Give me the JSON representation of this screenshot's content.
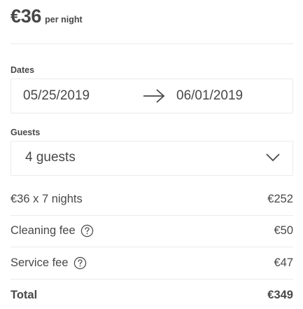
{
  "price": {
    "amount": "€36",
    "suffix": "per night"
  },
  "dates": {
    "label": "Dates",
    "check_in": "05/25/2019",
    "check_out": "06/01/2019",
    "arrow_icon": "arrow-right-icon"
  },
  "guests": {
    "label": "Guests",
    "value": "4 guests",
    "chevron_icon": "chevron-down-icon"
  },
  "breakdown": {
    "nights": {
      "label": "€36 x 7 nights",
      "amount": "€252"
    },
    "cleaning": {
      "label": "Cleaning fee",
      "amount": "€50",
      "help_icon": "question-circle-icon"
    },
    "service": {
      "label": "Service fee",
      "amount": "€47",
      "help_icon": "question-circle-icon"
    },
    "total": {
      "label": "Total",
      "amount": "€349"
    }
  }
}
